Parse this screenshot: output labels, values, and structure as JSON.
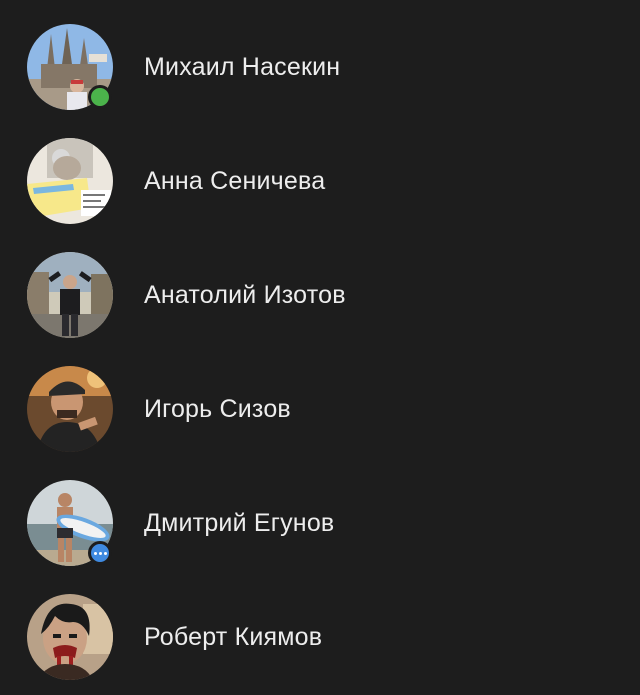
{
  "contacts": [
    {
      "name": "Михаил Насекин",
      "status": "online"
    },
    {
      "name": "Анна Сеничева",
      "status": "none"
    },
    {
      "name": "Анатолий Изотов",
      "status": "none"
    },
    {
      "name": "Игорь Сизов",
      "status": "none"
    },
    {
      "name": "Дмитрий Егунов",
      "status": "app"
    },
    {
      "name": "Роберт Киямов",
      "status": "none"
    }
  ],
  "colors": {
    "background": "#1d1d1d",
    "text": "#ededed",
    "online_badge": "#4bb34b",
    "app_badge": "#3f8ae0"
  }
}
